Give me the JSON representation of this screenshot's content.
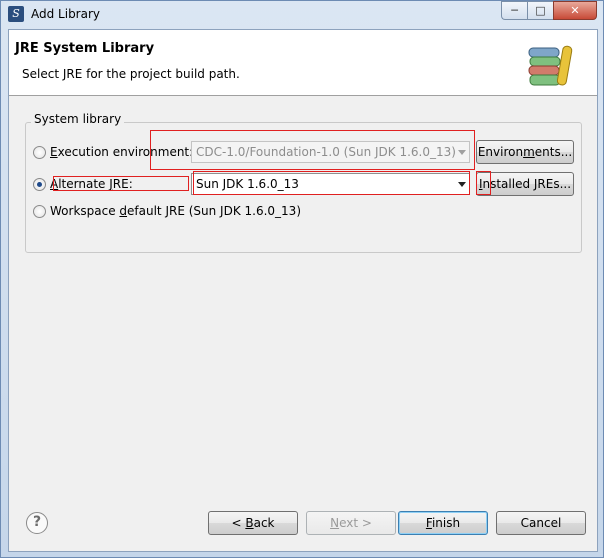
{
  "window": {
    "title": "Add Library",
    "controls": {
      "minimize": "─",
      "maximize": "□",
      "close": "✕"
    }
  },
  "header": {
    "title": "JRE System Library",
    "description": "Select JRE for the project build path."
  },
  "system_library": {
    "group_label": "System library",
    "options": [
      {
        "label_pre": "",
        "label_key": "E",
        "label_post": "xecution environment:",
        "checked": false
      },
      {
        "label_pre": "",
        "label_key": "A",
        "label_post": "lternate ",
        "label_key2": "J",
        "label_post2": "RE:",
        "checked": true
      },
      {
        "label_pre": "Workspace ",
        "label_key": "d",
        "label_post": "efault JRE (Sun JDK 1.6.0_13)",
        "checked": false
      }
    ],
    "execution_environment_value": "CDC-1.0/Foundation-1.0 (Sun JDK 1.6.0_13)",
    "alternate_jre_value": "Sun JDK 1.6.0_13",
    "environments_button": {
      "pre": "Environ",
      "key": "m",
      "post": "ents..."
    },
    "installed_jres_button": {
      "pre": "",
      "key": "I",
      "post": "nstalled JREs..."
    }
  },
  "footer": {
    "help": "?",
    "back": {
      "pre": "< ",
      "key": "B",
      "post": "ack"
    },
    "next": {
      "pre": "",
      "key": "N",
      "post": "ext >"
    },
    "finish": {
      "pre": "",
      "key": "F",
      "post": "inish"
    },
    "cancel": "Cancel"
  }
}
